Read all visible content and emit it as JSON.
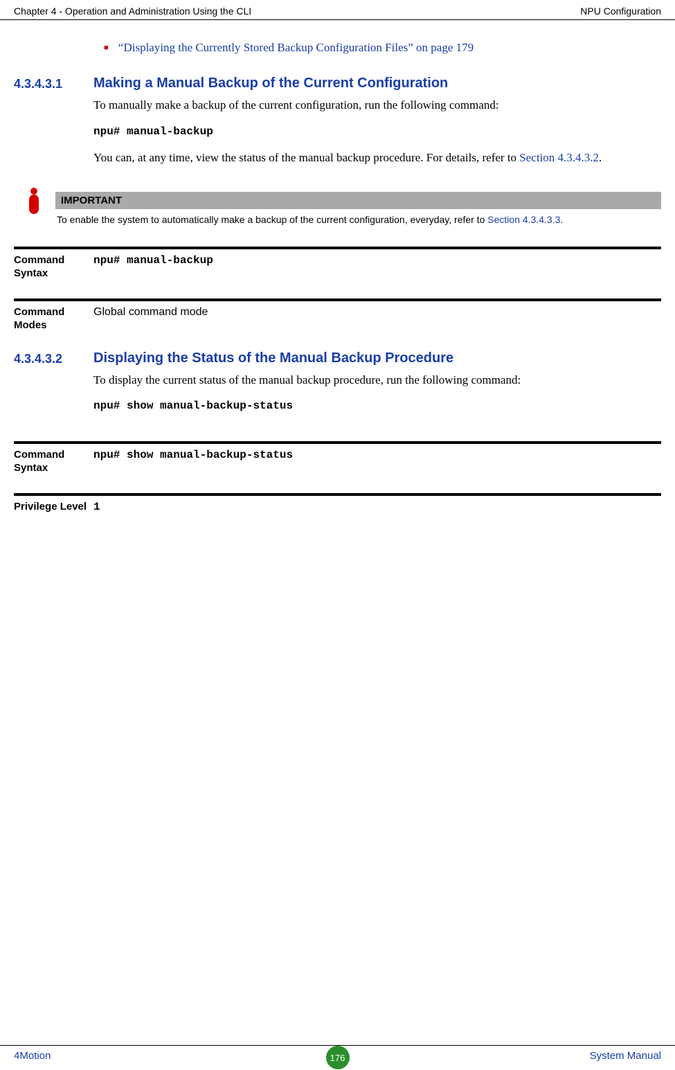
{
  "header": {
    "left": "Chapter 4 - Operation and Administration Using the CLI",
    "right": "NPU Configuration"
  },
  "bullet_link": "“Displaying the Currently Stored Backup Configuration Files” on page 179",
  "section1": {
    "num": "4.3.4.3.1",
    "title": "Making a Manual Backup of the Current Configuration",
    "p1": "To manually make a backup of the current configuration, run the following command:",
    "cmd": "npu# manual-backup",
    "p2a": "You can, at any time, view the status of the manual backup procedure. For details, refer to ",
    "p2link": "Section 4.3.4.3.2",
    "p2b": "."
  },
  "important": {
    "label": "IMPORTANT",
    "text_a": "To enable the system to automatically make a backup of the current configuration, everyday, refer to ",
    "text_link": "Section 4.3.4.3.3",
    "text_b": "."
  },
  "cmdblock1": {
    "label": "Command Syntax",
    "value": "npu# manual-backup"
  },
  "cmdblock2": {
    "label": "Command Modes",
    "value": "Global command mode"
  },
  "section2": {
    "num": "4.3.4.3.2",
    "title": "Displaying the Status of the Manual Backup Procedure",
    "p1": "To display the current status of the manual backup procedure, run the following command:",
    "cmd": "npu# show manual-backup-status"
  },
  "cmdblock3": {
    "label": "Command Syntax",
    "value": "npu# show manual-backup-status"
  },
  "cmdblock4": {
    "label": "Privilege Level",
    "value": "1"
  },
  "footer": {
    "left": "4Motion",
    "center": "176",
    "right": "System Manual"
  }
}
